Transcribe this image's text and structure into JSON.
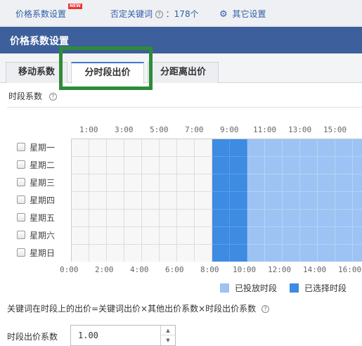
{
  "topnav": {
    "price_coef_label": "价格系数设置",
    "new_badge": "NEW",
    "negative_keywords_label": "否定关键词",
    "negative_keywords_count": "：178个",
    "other_settings_label": "其它设置"
  },
  "title": "价格系数设置",
  "tabs": [
    "移动系数",
    "分时段出价",
    "分距离出价"
  ],
  "active_tab": "分时段出价",
  "section": {
    "label": "时段系数"
  },
  "schedule": {
    "top_ticks": [
      "1:00",
      "3:00",
      "5:00",
      "7:00",
      "9:00",
      "11:00",
      "13:00",
      "15:00"
    ],
    "bottom_ticks": [
      "0:00",
      "2:00",
      "4:00",
      "6:00",
      "8:00",
      "10:00",
      "12:00",
      "14:00",
      "16:00"
    ],
    "days": [
      "星期一",
      "星期二",
      "星期三",
      "星期四",
      "星期五",
      "星期六",
      "星期日"
    ],
    "selected_hours": [
      8,
      9
    ],
    "placed_hours_from": 10,
    "colors": {
      "empty": "#f7f7f7",
      "placed": "#9cc3f3",
      "selected": "#3e8be3"
    }
  },
  "legend": {
    "placed_label": "已投放时段",
    "selected_label": "已选择时段"
  },
  "formula": "关键词在时段上的出价=关键词出价×其他出价系数×时段出价系数",
  "coefficient": {
    "label": "时段出价系数",
    "value": "1.00"
  }
}
